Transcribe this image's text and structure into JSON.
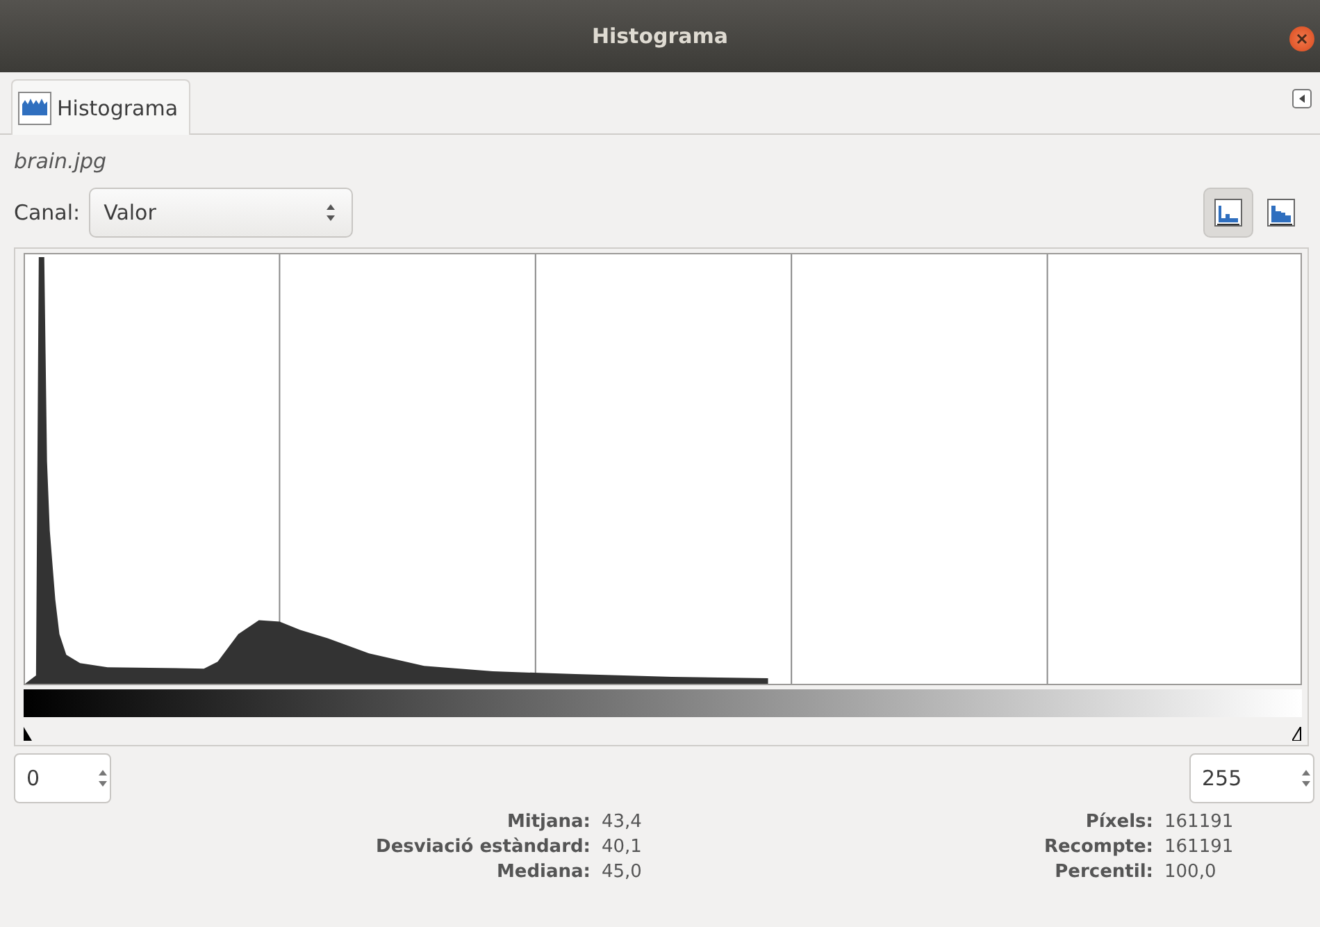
{
  "window": {
    "title": "Histograma"
  },
  "tabs": [
    {
      "label": "Histograma",
      "selected": true
    }
  ],
  "image_name": "brain.jpg",
  "channel": {
    "label": "Canal:",
    "value": "Valor"
  },
  "view_modes": [
    {
      "kind": "linear",
      "selected": true
    },
    {
      "kind": "logarithmic",
      "selected": false
    }
  ],
  "range": {
    "start": "0",
    "end": "255"
  },
  "stats_left": [
    {
      "label": "Mitjana:",
      "value": "43,4"
    },
    {
      "label": "Desviació estàndard:",
      "value": "40,1"
    },
    {
      "label": "Mediana:",
      "value": "45,0"
    }
  ],
  "stats_right": [
    {
      "label": "Píxels:",
      "value": "161191"
    },
    {
      "label": "Recompte:",
      "value": "161191"
    },
    {
      "label": "Percentil:",
      "value": "100,0"
    }
  ]
}
